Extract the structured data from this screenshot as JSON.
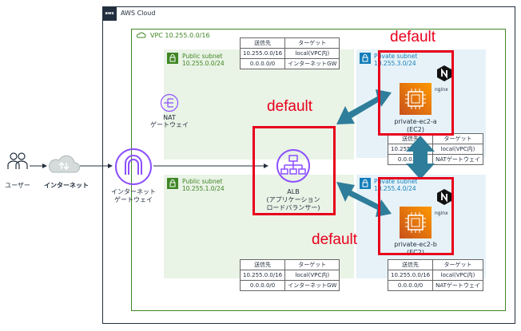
{
  "aws_cloud": {
    "label": "AWS Cloud",
    "badge": "aws"
  },
  "vpc": {
    "label": "VPC 10.255.0.0/16"
  },
  "user": {
    "label": "ユーザー"
  },
  "internet": {
    "label": "インターネット"
  },
  "igw": {
    "line1": "インターネット",
    "line2": "ゲートウェイ"
  },
  "nat": {
    "line1": "NAT",
    "line2": "ゲートウェイ"
  },
  "public_subnets": [
    {
      "title": "Public subnet",
      "cidr": "10.255.0.0/24"
    },
    {
      "title": "Public subnet",
      "cidr": "10.255.1.0/24"
    }
  ],
  "private_subnets": [
    {
      "title": "Private subnet",
      "cidr": "10.255.3.0/24"
    },
    {
      "title": "Private subnet",
      "cidr": "10.255.4.0/24"
    }
  ],
  "alb": {
    "line1": "ALB",
    "line2": "(アプリケーション",
    "line3": "ロードバランサー)"
  },
  "ec2": [
    {
      "name": "private-ec2-a",
      "type": "(EC2)",
      "app": "nginx"
    },
    {
      "name": "private-ec2-b",
      "type": "(EC2)",
      "app": "nginx"
    }
  ],
  "route_tables": {
    "headers": [
      "送信先",
      "ターゲット"
    ],
    "public": [
      [
        "10.255.0.0/16",
        "local(VPC内)"
      ],
      [
        "0.0.0.0/0",
        "インターネットGW"
      ]
    ],
    "private": [
      [
        "10.255.0.0/16",
        "local(VPC内)"
      ],
      [
        "0.0.0.0/0",
        "NATゲートウェイ"
      ]
    ]
  },
  "annotations": [
    "default",
    "default",
    "default"
  ],
  "colors": {
    "annotation": "#e8001c",
    "arrow": "#2e7d9a",
    "ec2": "#ff9900",
    "alb": "#8c4fff"
  }
}
